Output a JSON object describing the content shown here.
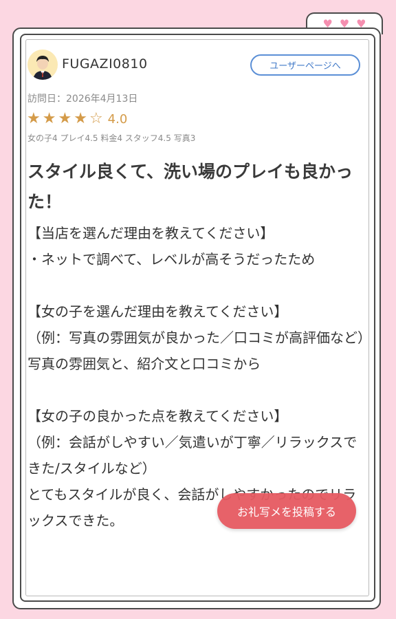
{
  "decor": {
    "hearts": [
      "♥",
      "♥",
      "♥"
    ]
  },
  "review": {
    "username": "FUGAZI0810",
    "user_page_button": "ユーザーページへ",
    "visit_date": "訪問日：2026年4月13日",
    "rating": {
      "stars_filled": 4,
      "stars_total": 5,
      "score": "4.0"
    },
    "sub_ratings": "女の子4 プレイ4.5 料金4 スタッフ4.5 写真3",
    "title": "スタイル良くて、洗い場のプレイも良かった！",
    "body": [
      "【当店を選んだ理由を教えてください】",
      "・ネットで調べて、レベルが高そうだったため",
      "",
      "【女の子を選んだ理由を教えてください】",
      "（例：写真の雰囲気が良かった／口コミが高評価など）",
      "写真の雰囲気と、紹介文と口コミから",
      "",
      "【女の子の良かった点を教えてください】",
      "（例：会話がしやすい／気遣いが丁寧／リラックスできた/スタイルなど）",
      "とてもスタイルが良く、会話がしやすかったのでリラックスできた。"
    ]
  },
  "fab_label": "お礼写メを投稿する"
}
